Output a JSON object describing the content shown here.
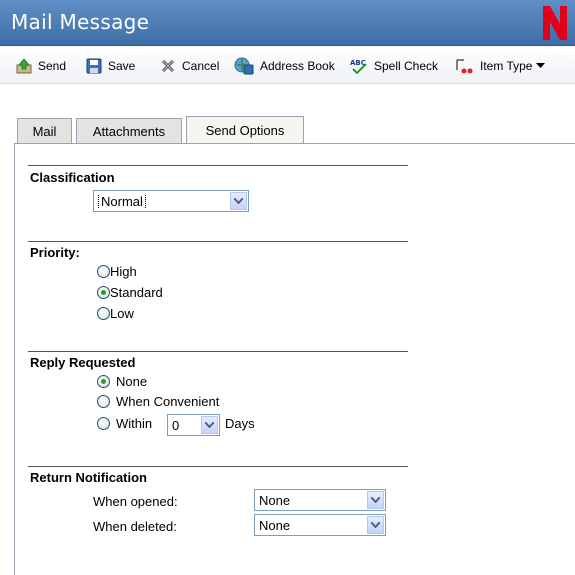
{
  "window": {
    "title": "Mail Message",
    "logo_icon": "novell-n-logo",
    "logo_color": "#e3001b"
  },
  "toolbar": {
    "send": {
      "label": "Send",
      "icon": "send-icon"
    },
    "save": {
      "label": "Save",
      "icon": "save-icon"
    },
    "cancel": {
      "label": "Cancel",
      "icon": "cancel-icon"
    },
    "address_book": {
      "label": "Address Book",
      "icon": "address-book-icon"
    },
    "spell_check": {
      "label": "Spell Check",
      "icon": "spell-check-icon"
    },
    "item_type": {
      "label": "Item Type",
      "icon": "item-type-icon"
    }
  },
  "tabs": [
    {
      "label": "Mail",
      "active": false
    },
    {
      "label": "Attachments",
      "active": false
    },
    {
      "label": "Send Options",
      "active": true
    }
  ],
  "classification": {
    "title": "Classification",
    "selected": "Normal"
  },
  "priority": {
    "title": "Priority:",
    "options": [
      {
        "label": "High",
        "checked": false
      },
      {
        "label": "Standard",
        "checked": true
      },
      {
        "label": "Low",
        "checked": false
      }
    ]
  },
  "reply_requested": {
    "title": "Reply Requested",
    "options": [
      {
        "label": "None",
        "checked": true
      },
      {
        "label": "When Convenient",
        "checked": false
      },
      {
        "label": "Within",
        "checked": false
      }
    ],
    "within_value": "0",
    "days_label": "Days"
  },
  "return_notification": {
    "title": "Return Notification",
    "when_opened_label": "When opened:",
    "when_opened_value": "None",
    "when_deleted_label": "When deleted:",
    "when_deleted_value": "None"
  },
  "colors": {
    "titlebar": "#4a7ab3",
    "radio_checked": "#21a121",
    "select_border": "#7f9db9"
  }
}
